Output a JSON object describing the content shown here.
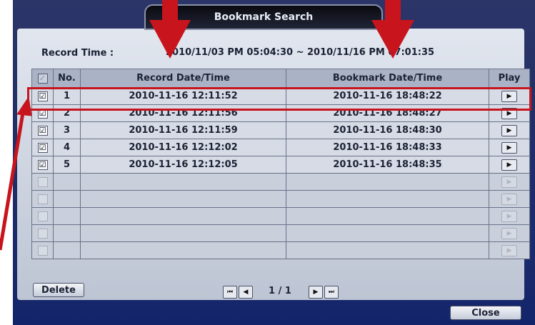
{
  "window": {
    "title": "Bookmark Search"
  },
  "record_time": {
    "label": "Record Time :",
    "value": "2010/11/03 PM 05:04:30 ~ 2010/11/16 PM 07:01:35"
  },
  "table": {
    "headers": {
      "no": "No.",
      "record": "Record Date/Time",
      "bookmark": "Bookmark Date/Time",
      "play": "Play"
    },
    "rows": [
      {
        "no": "1",
        "record": "2010-11-16 12:11:52",
        "bookmark": "2010-11-16 18:48:22",
        "checked": true
      },
      {
        "no": "2",
        "record": "2010-11-16 12:11:56",
        "bookmark": "2010-11-16 18:48:27",
        "checked": true
      },
      {
        "no": "3",
        "record": "2010-11-16 12:11:59",
        "bookmark": "2010-11-16 18:48:30",
        "checked": true
      },
      {
        "no": "4",
        "record": "2010-11-16 12:12:02",
        "bookmark": "2010-11-16 18:48:33",
        "checked": true
      },
      {
        "no": "5",
        "record": "2010-11-16 12:12:05",
        "bookmark": "2010-11-16 18:48:35",
        "checked": true
      }
    ],
    "empty_row_count": 5
  },
  "footer": {
    "delete_label": "Delete",
    "page_indicator": "1 / 1",
    "close_label": "Close"
  },
  "icons": {
    "checkmark": "☑",
    "play": "▶",
    "first_page": "⏮",
    "prev_page": "◀",
    "next_page": "▶",
    "last_page": "⏭"
  },
  "colors": {
    "annotation_red": "#c8141c",
    "screen_blue": "#1a2a6a"
  }
}
